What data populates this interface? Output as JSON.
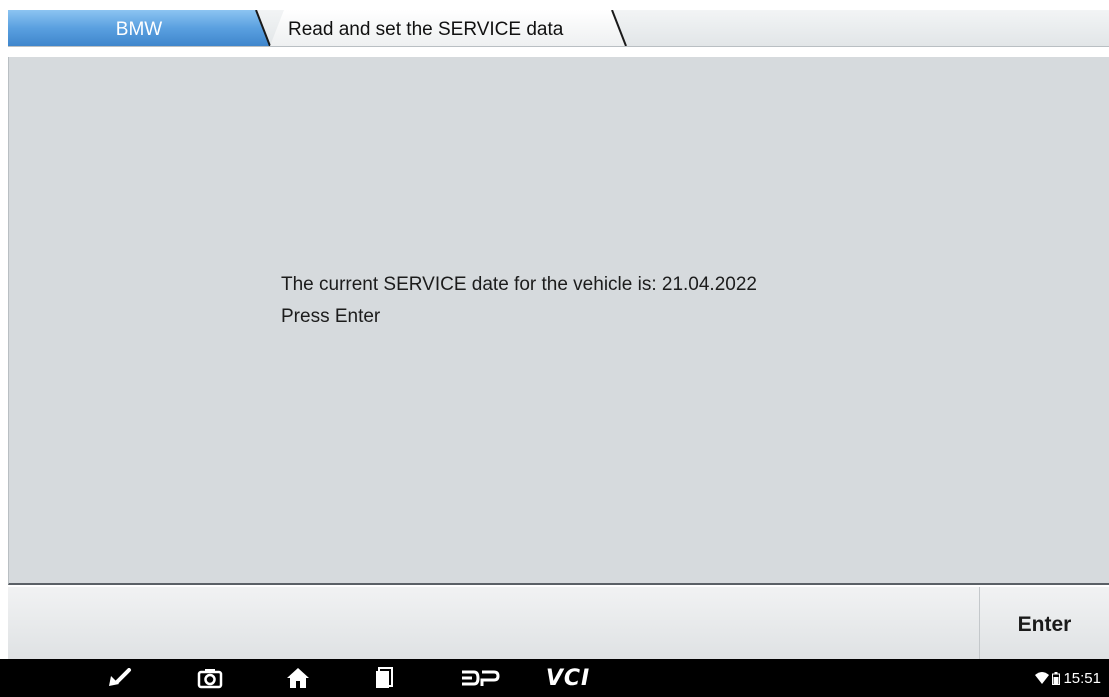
{
  "breadcrumb": {
    "items": [
      {
        "label": "BMW"
      },
      {
        "label": "Read and set the SERVICE data"
      }
    ]
  },
  "content": {
    "message_line1": "The current SERVICE date for the vehicle is: 21.04.2022",
    "message_line2": "Press Enter"
  },
  "buttons": {
    "enter_label": "Enter"
  },
  "navbar": {
    "icons": [
      "back-icon",
      "camera-icon",
      "home-icon",
      "recent-apps-icon",
      "dp-icon",
      "vci-icon"
    ],
    "vci_label": "VCI"
  },
  "status": {
    "time": "15:51",
    "icons": [
      "wifi-icon",
      "battery-icon"
    ]
  },
  "colors": {
    "tab_active": "#5aa0e0",
    "content_bg": "#d6dadd",
    "navbar_bg": "#000000"
  }
}
